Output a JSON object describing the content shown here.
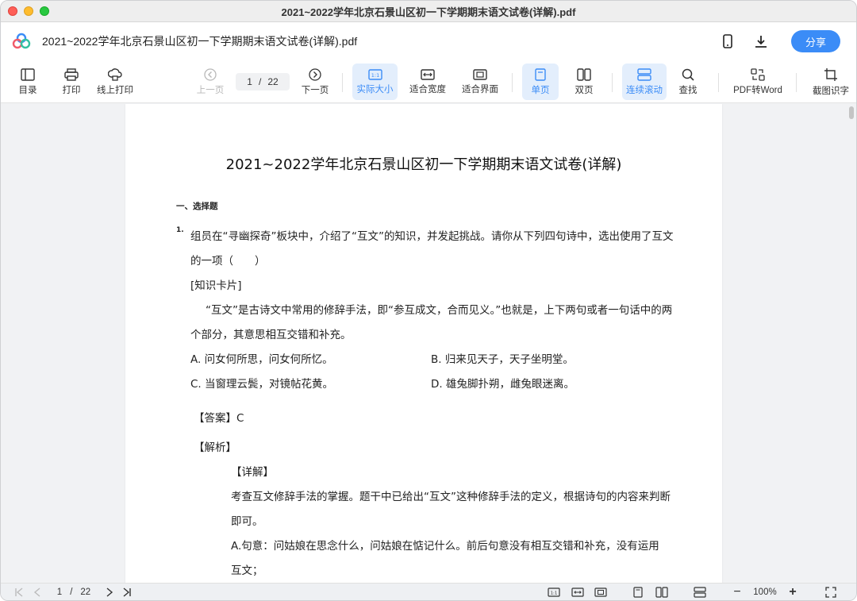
{
  "window": {
    "title": "2021~2022学年北京石景山区初一下学期期末语文试卷(详解).pdf"
  },
  "appbar": {
    "doc_name": "2021~2022学年北京石景山区初一下学期期末语文试卷(详解).pdf",
    "share_label": "分享"
  },
  "toolbar": {
    "toc": "目录",
    "print": "打印",
    "online_print": "线上打印",
    "prev": "上一页",
    "page_current": "1",
    "page_sep": "/",
    "page_total": "22",
    "next": "下一页",
    "actual_size": "实际大小",
    "fit_width": "适合宽度",
    "fit_page": "适合界面",
    "single": "单页",
    "double": "双页",
    "continuous": "连续滚动",
    "find": "查找",
    "pdf_word": "PDF转Word",
    "ocr": "截图识字"
  },
  "document": {
    "title": "2021~2022学年北京石景山区初一下学期期末语文试卷(详解)",
    "section": "一、选择题",
    "q_num": "1.",
    "q_line1": "组员在“寻幽探奇”板块中，介绍了“互文”的知识，并发起挑战。请你从下列四句诗中，选出使用了互文",
    "q_line2": "的一项（　　）",
    "card_title": "[知识卡片]",
    "card_line1": "“互文”是古诗文中常用的修辞手法，即“参互成文，合而见义。”也就是，上下两句或者一句话中的两",
    "card_line2": "个部分，其意思相互交错和补充。",
    "opt_a": "A. 问女何所思，问女何所忆。",
    "opt_b": "B. 归来见天子，天子坐明堂。",
    "opt_c": "C. 当窗理云鬓，对镜帖花黄。",
    "opt_d": "D. 雄兔脚扑朔，雌兔眼迷离。",
    "answer": "【答案】C",
    "analysis": "【解析】",
    "detail": "【详解】",
    "exp_line1": "考查互文修辞手法的掌握。题干中已给出“互文”这种修辞手法的定义，根据诗句的内容来判断",
    "exp_line2": "即可。",
    "exp_line3": "A.句意：问姑娘在思念什么，问姑娘在惦记什么。前后句意没有相互交错和补充，没有运用",
    "exp_line4": "互文；"
  },
  "statusbar": {
    "page_current": "1",
    "page_sep": "/",
    "page_total": "22",
    "zoom": "100%",
    "minus": "−",
    "plus": "+"
  },
  "colors": {
    "accent": "#3b8cf7",
    "active_bg": "#e3eefc"
  }
}
